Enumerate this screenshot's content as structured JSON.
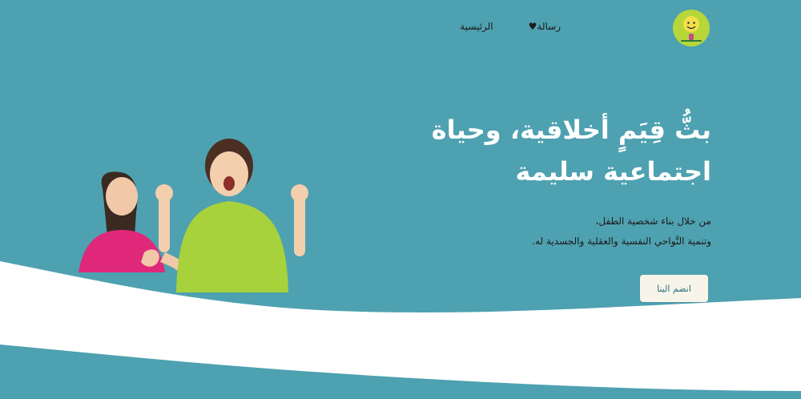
{
  "header": {
    "nav": [
      {
        "label": "الرئيسية"
      },
      {
        "label": "رسالة♥"
      }
    ],
    "logo_icon": "smiling-sun-logo-icon"
  },
  "hero": {
    "title_line1": "بثُّ قِيَمٍ أخلاقية، وحياة",
    "title_line2": "اجتماعية سليمة",
    "subtitle_line1": "من خلال بناء شخصية الطفل،",
    "subtitle_line2": "وتنمية النَّواحي النفسية والعقلية والجسدية له.",
    "cta_label": "انضم الينا",
    "image": "two-happy-children-image"
  },
  "colors": {
    "background": "#4ea1b0",
    "wave": "#ffffff",
    "logo": "#b7d63a",
    "cta_background": "#f7f5ea",
    "cta_text": "#2d6f7d"
  }
}
